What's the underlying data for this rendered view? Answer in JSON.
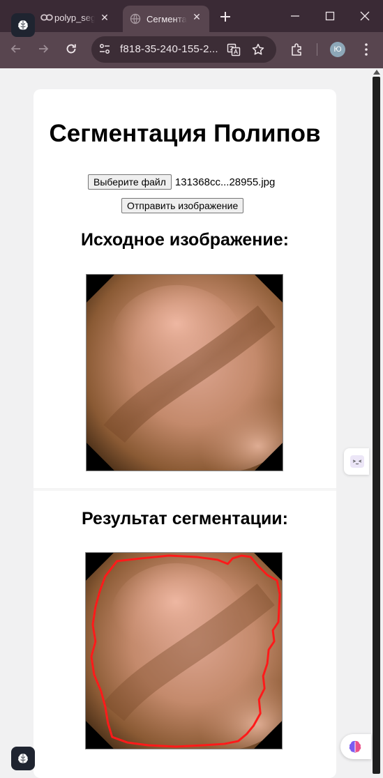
{
  "browser": {
    "tabs": [
      {
        "title": "polyp_seg",
        "active": false
      },
      {
        "title": "Сегментация",
        "active": true
      }
    ],
    "url": "f818-35-240-155-2...",
    "profile_initial": "Ю",
    "frame_color": "#3a2a35",
    "toolbar_color": "#58454f"
  },
  "page": {
    "title": "Сегментация Полипов",
    "choose_file_label": "Выберите файл",
    "file_name": "131368cc...28955.jpg",
    "submit_label": "Отправить изображение",
    "original_heading": "Исходное изображение:",
    "result_heading": "Результат сегментации:",
    "contour_color": "#ff1a1a"
  }
}
